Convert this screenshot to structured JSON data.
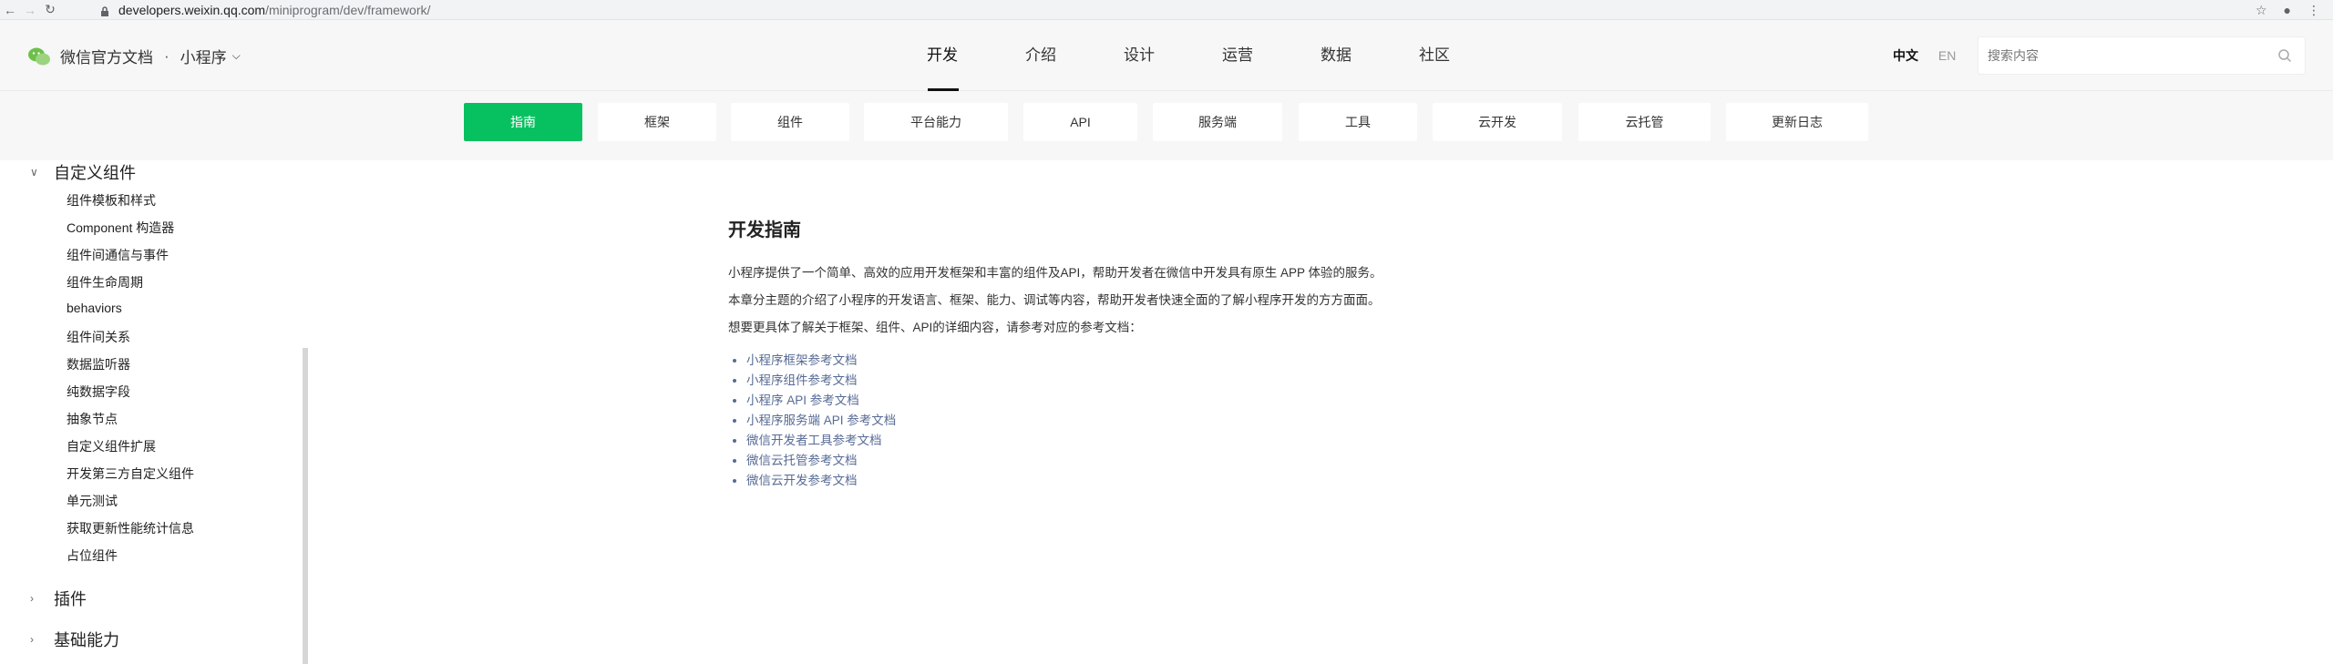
{
  "browser": {
    "url_host": "developers.weixin.qq.com",
    "url_path": "/miniprogram/dev/framework/"
  },
  "header": {
    "logo_text": "微信官方文档",
    "separator": "·",
    "product": "小程序",
    "nav": [
      "开发",
      "介绍",
      "设计",
      "运营",
      "数据",
      "社区"
    ],
    "active_nav": "开发",
    "lang_zh": "中文",
    "lang_en": "EN",
    "search_placeholder": "搜索内容"
  },
  "subtabs": [
    "指南",
    "框架",
    "组件",
    "平台能力",
    "API",
    "服务端",
    "工具",
    "云开发",
    "云托管",
    "更新日志"
  ],
  "sidebar": {
    "group_open": "自定义组件",
    "items": [
      "组件模板和样式",
      "Component 构造器",
      "组件间通信与事件",
      "组件生命周期",
      "behaviors",
      "组件间关系",
      "数据监听器",
      "纯数据字段",
      "抽象节点",
      "自定义组件扩展",
      "开发第三方自定义组件",
      "单元测试",
      "获取更新性能统计信息",
      "占位组件"
    ],
    "groups_closed": [
      "插件",
      "基础能力"
    ]
  },
  "content": {
    "title": "开发指南",
    "paragraphs": [
      "小程序提供了一个简单、高效的应用开发框架和丰富的组件及API，帮助开发者在微信中开发具有原生 APP 体验的服务。",
      "本章分主题的介绍了小程序的开发语言、框架、能力、调试等内容，帮助开发者快速全面的了解小程序开发的方方面面。",
      "想要更具体了解关于框架、组件、API的详细内容，请参考对应的参考文档："
    ],
    "links": [
      "小程序框架参考文档",
      "小程序组件参考文档",
      "小程序 API 参考文档",
      "小程序服务端 API 参考文档",
      "微信开发者工具参考文档",
      "微信云托管参考文档",
      "微信云开发参考文档"
    ]
  },
  "colors": {
    "accent": "#07c160",
    "link": "#576b95"
  }
}
